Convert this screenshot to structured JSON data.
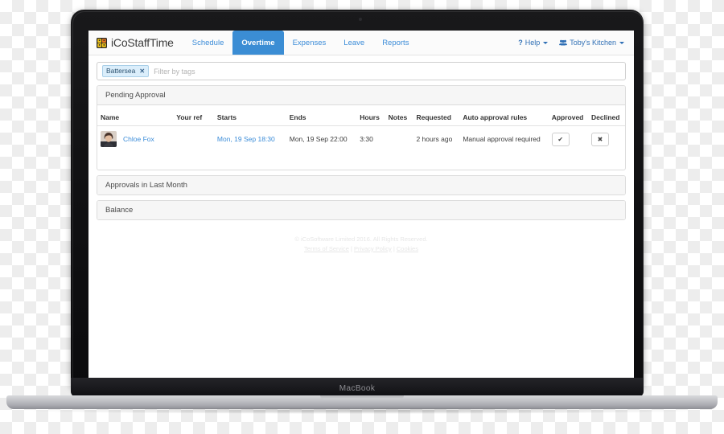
{
  "device": {
    "model_label": "MacBook"
  },
  "app": {
    "brand_name": "iCoStaffTime",
    "brand_logo_icon": "people-squares-logo-icon",
    "nav": [
      {
        "label": "Schedule",
        "active": false
      },
      {
        "label": "Overtime",
        "active": true
      },
      {
        "label": "Expenses",
        "active": false
      },
      {
        "label": "Leave",
        "active": false
      },
      {
        "label": "Reports",
        "active": false
      }
    ],
    "nav_right": {
      "help_label": "Help",
      "help_icon": "question-mark-icon",
      "account_label": "Toby's Kitchen",
      "account_icon": "users-group-icon"
    },
    "accent_color": "#3b8dd4",
    "link_color": "#3b8cd8"
  },
  "filter": {
    "tag_label": "Battersea",
    "tag_remove_icon": "close-x-icon",
    "placeholder": "Filter by tags"
  },
  "panels": [
    {
      "title": "Pending Approval",
      "collapsed": false
    },
    {
      "title": "Approvals in Last Month",
      "collapsed": true
    },
    {
      "title": "Balance",
      "collapsed": true
    }
  ],
  "table": {
    "columns": [
      "Name",
      "Your ref",
      "Starts",
      "Ends",
      "Hours",
      "Notes",
      "Requested",
      "Auto approval rules",
      "Approved",
      "Declined"
    ],
    "rows": [
      {
        "avatar_icon": "user-avatar-photo",
        "name": "Chloe Fox",
        "your_ref": "",
        "starts": "Mon, 19 Sep 18:30",
        "ends": "Mon, 19 Sep 22:00",
        "hours": "3:30",
        "notes": "",
        "requested": "2 hours ago",
        "auto_approval_rules": "Manual approval required",
        "approve_icon": "check-icon",
        "decline_icon": "cross-icon"
      }
    ]
  },
  "footer": {
    "copyright": "© iCoSoftware Limited 2016. All Rights Reserved.",
    "links": [
      {
        "label": "Terms of Service"
      },
      {
        "label": "Privacy Policy"
      },
      {
        "label": "Cookies"
      }
    ],
    "separator": "|"
  }
}
